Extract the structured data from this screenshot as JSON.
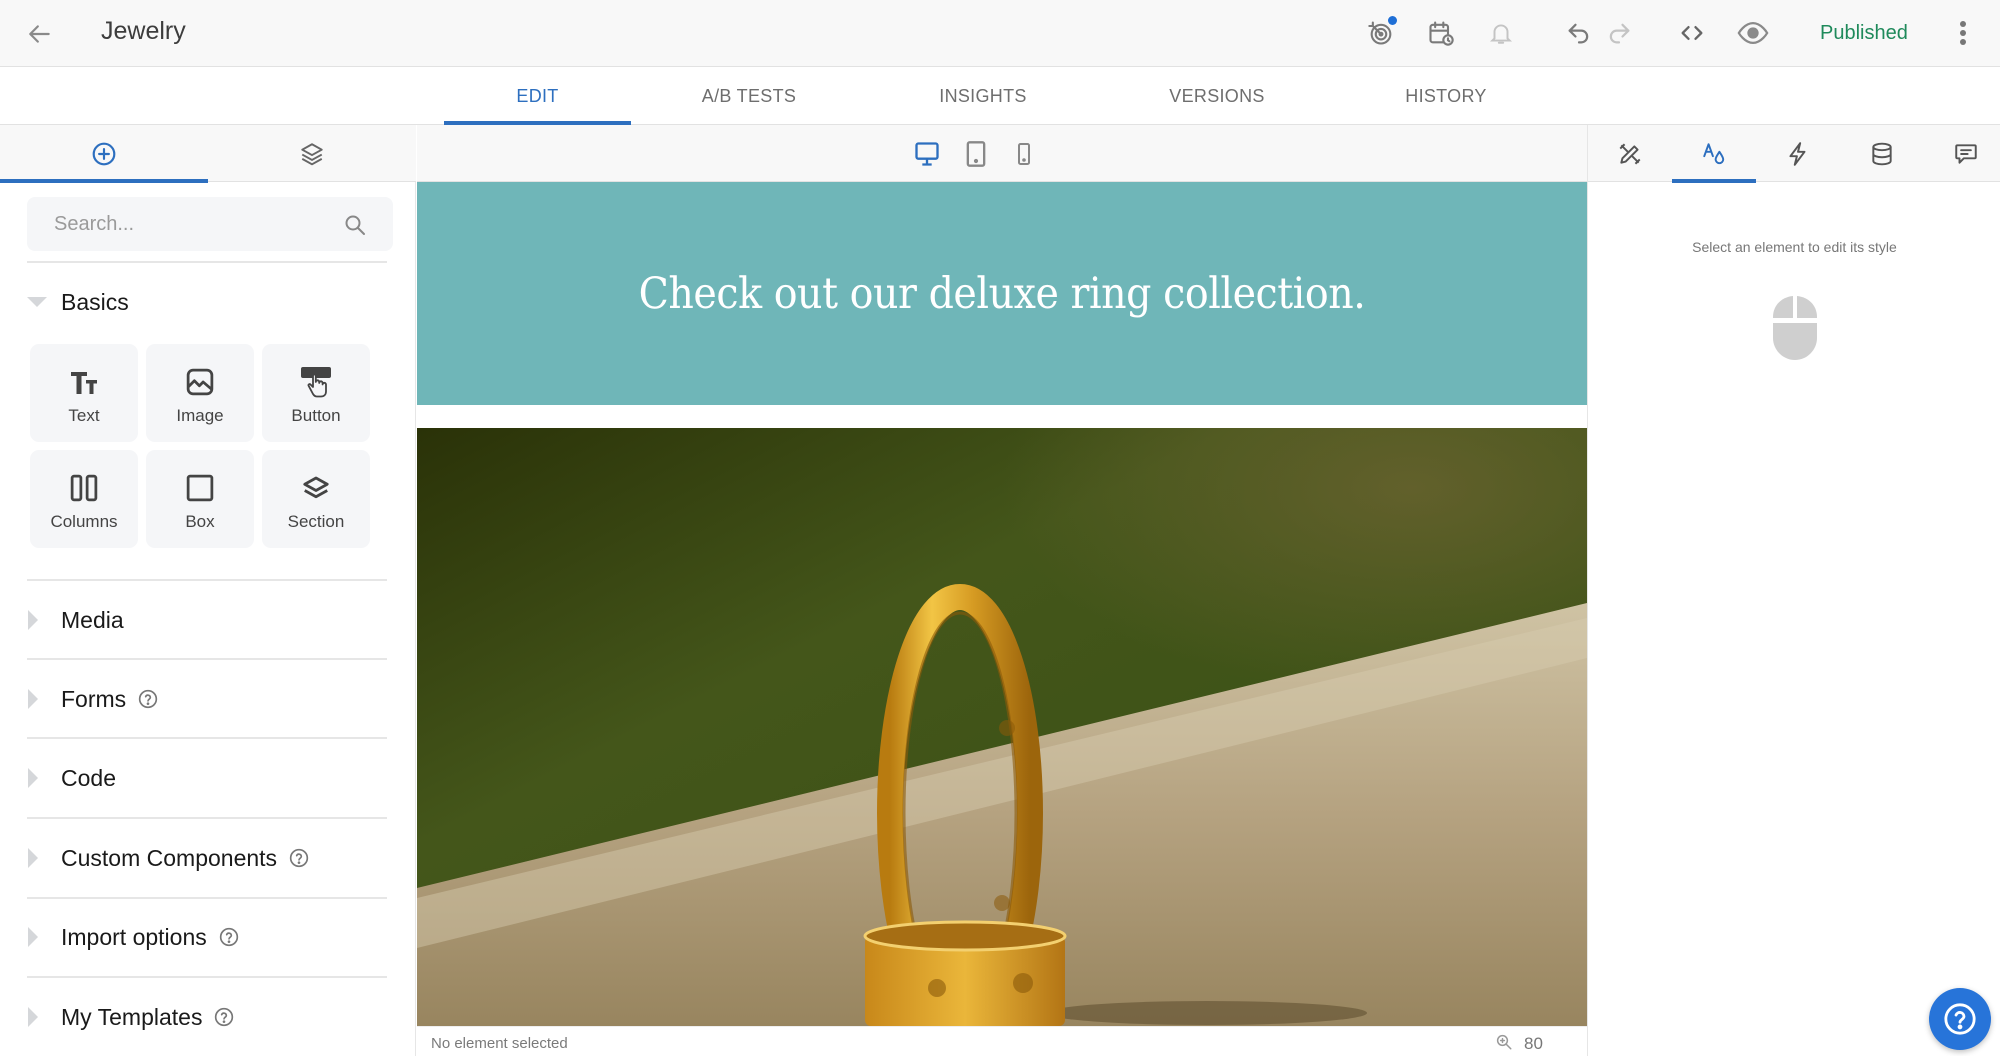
{
  "header": {
    "title": "Jewelry",
    "status_label": "Published",
    "icons": [
      "back-arrow-icon",
      "goals-target-icon",
      "schedule-calendar-icon",
      "notifications-bell-icon",
      "undo-icon",
      "redo-icon",
      "code-icon",
      "preview-eye-icon",
      "more-vertical-icon"
    ],
    "status_color": "#1f8a5b",
    "accent_color": "#2d6fbf"
  },
  "main_tabs": [
    {
      "label": "EDIT",
      "active": true
    },
    {
      "label": "A/B TESTS",
      "active": false
    },
    {
      "label": "INSIGHTS",
      "active": false
    },
    {
      "label": "VERSIONS",
      "active": false
    },
    {
      "label": "HISTORY",
      "active": false
    }
  ],
  "left_panel": {
    "tabs": [
      {
        "icon": "add-circle-icon",
        "active": true
      },
      {
        "icon": "layers-icon",
        "active": false
      }
    ],
    "search": {
      "placeholder": "Search...",
      "value": ""
    },
    "basics": {
      "label": "Basics",
      "expanded": true,
      "tiles": [
        {
          "label": "Text",
          "icon": "text-icon"
        },
        {
          "label": "Image",
          "icon": "image-icon"
        },
        {
          "label": "Button",
          "icon": "button-click-icon"
        },
        {
          "label": "Columns",
          "icon": "columns-icon"
        },
        {
          "label": "Box",
          "icon": "box-icon"
        },
        {
          "label": "Section",
          "icon": "section-layers-icon"
        }
      ]
    },
    "sections": [
      {
        "label": "Media",
        "help": false
      },
      {
        "label": "Forms",
        "help": true
      },
      {
        "label": "Code",
        "help": false
      },
      {
        "label": "Custom Components",
        "help": true
      },
      {
        "label": "Import options",
        "help": true
      },
      {
        "label": "My Templates",
        "help": true
      }
    ]
  },
  "canvas": {
    "devices": [
      {
        "name": "desktop",
        "active": true
      },
      {
        "name": "tablet",
        "active": false
      },
      {
        "name": "mobile",
        "active": false
      }
    ],
    "hero_text": "Check out our deluxe ring collection.",
    "hero_color": "#6fb6b8",
    "image_alt": "Two gold rings on a stone ledge",
    "status_text": "No element selected",
    "zoom_level": "80"
  },
  "right_panel": {
    "tabs": [
      {
        "icon": "design-tools-icon",
        "active": false
      },
      {
        "icon": "style-icon",
        "active": true
      },
      {
        "icon": "interactions-bolt-icon",
        "active": false
      },
      {
        "icon": "data-database-icon",
        "active": false
      },
      {
        "icon": "comments-icon",
        "active": false
      }
    ],
    "hint": "Select an element to edit its style"
  }
}
